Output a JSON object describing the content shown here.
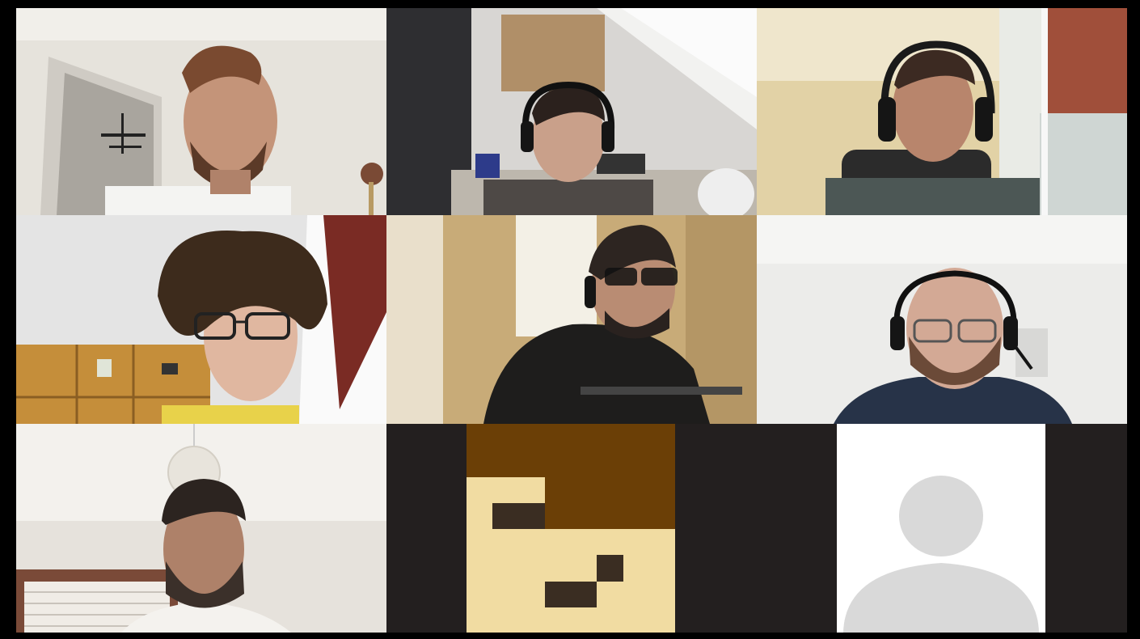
{
  "app": {
    "layout": "gallery-view",
    "grid": "3x3"
  },
  "participants": [
    {
      "slot": 1,
      "feed": "video",
      "description_icon": "person-video-feed"
    },
    {
      "slot": 2,
      "feed": "video",
      "description_icon": "person-video-feed"
    },
    {
      "slot": 3,
      "feed": "video",
      "description_icon": "person-video-feed"
    },
    {
      "slot": 4,
      "feed": "video",
      "description_icon": "person-video-feed"
    },
    {
      "slot": 5,
      "feed": "video",
      "description_icon": "person-video-feed"
    },
    {
      "slot": 6,
      "feed": "video",
      "description_icon": "person-video-feed"
    },
    {
      "slot": 7,
      "feed": "video",
      "description_icon": "person-video-feed"
    },
    {
      "slot": 8,
      "feed": "avatar",
      "avatar_icon": "pixel-face-avatar-icon"
    },
    {
      "slot": 9,
      "feed": "avatar",
      "avatar_icon": "default-user-avatar-icon"
    }
  ],
  "colors": {
    "background": "#000000",
    "empty_tile": "#231f1f",
    "pixel_hair": "#6b3f06",
    "pixel_skin": "#f1dca2",
    "pixel_dark": "#3a2d22",
    "generic_avatar_bg": "#ffffff",
    "generic_avatar_fg": "#d9d9d9"
  }
}
